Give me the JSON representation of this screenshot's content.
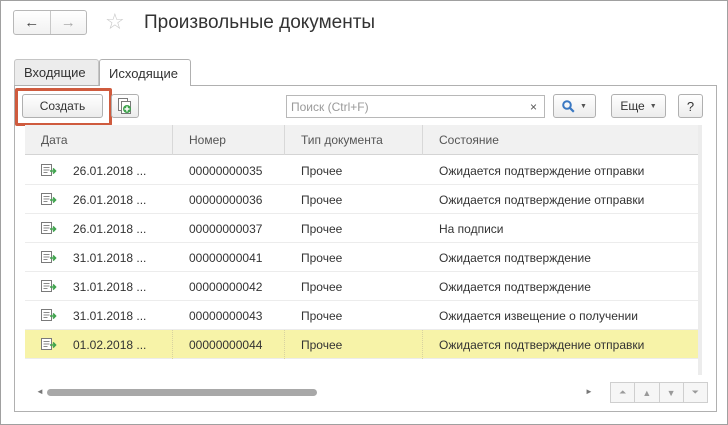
{
  "header": {
    "title": "Произвольные документы",
    "back_icon": "←",
    "forward_icon": "→",
    "star_icon": "☆"
  },
  "tabs": [
    {
      "label": "Входящие",
      "active": false
    },
    {
      "label": "Исходящие",
      "active": true
    }
  ],
  "toolbar": {
    "create_label": "Создать",
    "search_placeholder": "Поиск (Ctrl+F)",
    "clear_label": "×",
    "more_label": "Еще",
    "help_label": "?",
    "highlight_color": "#cf5b3e"
  },
  "table": {
    "columns": [
      "Дата",
      "Номер",
      "Тип документа",
      "Состояние"
    ],
    "rows": [
      {
        "date": "26.01.2018 ...",
        "number": "00000000035",
        "type": "Прочее",
        "status": "Ожидается подтверждение отправки",
        "selected": false
      },
      {
        "date": "26.01.2018 ...",
        "number": "00000000036",
        "type": "Прочее",
        "status": "Ожидается подтверждение отправки",
        "selected": false
      },
      {
        "date": "26.01.2018 ...",
        "number": "00000000037",
        "type": "Прочее",
        "status": "На подписи",
        "selected": false
      },
      {
        "date": "31.01.2018 ...",
        "number": "00000000041",
        "type": "Прочее",
        "status": "Ожидается подтверждение",
        "selected": false
      },
      {
        "date": "31.01.2018 ...",
        "number": "00000000042",
        "type": "Прочее",
        "status": "Ожидается подтверждение",
        "selected": false
      },
      {
        "date": "31.01.2018 ...",
        "number": "00000000043",
        "type": "Прочее",
        "status": "Ожидается извещение о получении",
        "selected": false
      },
      {
        "date": "01.02.2018 ...",
        "number": "00000000044",
        "type": "Прочее",
        "status": "Ожидается подтверждение отправки",
        "selected": true
      }
    ],
    "selected_row_color": "#f7f3a8"
  },
  "footer": {
    "scroll_left_icon": "◄",
    "scroll_right_icon": "►",
    "nav_icons": [
      "⏶",
      "▲",
      "▼",
      "⏷"
    ]
  }
}
